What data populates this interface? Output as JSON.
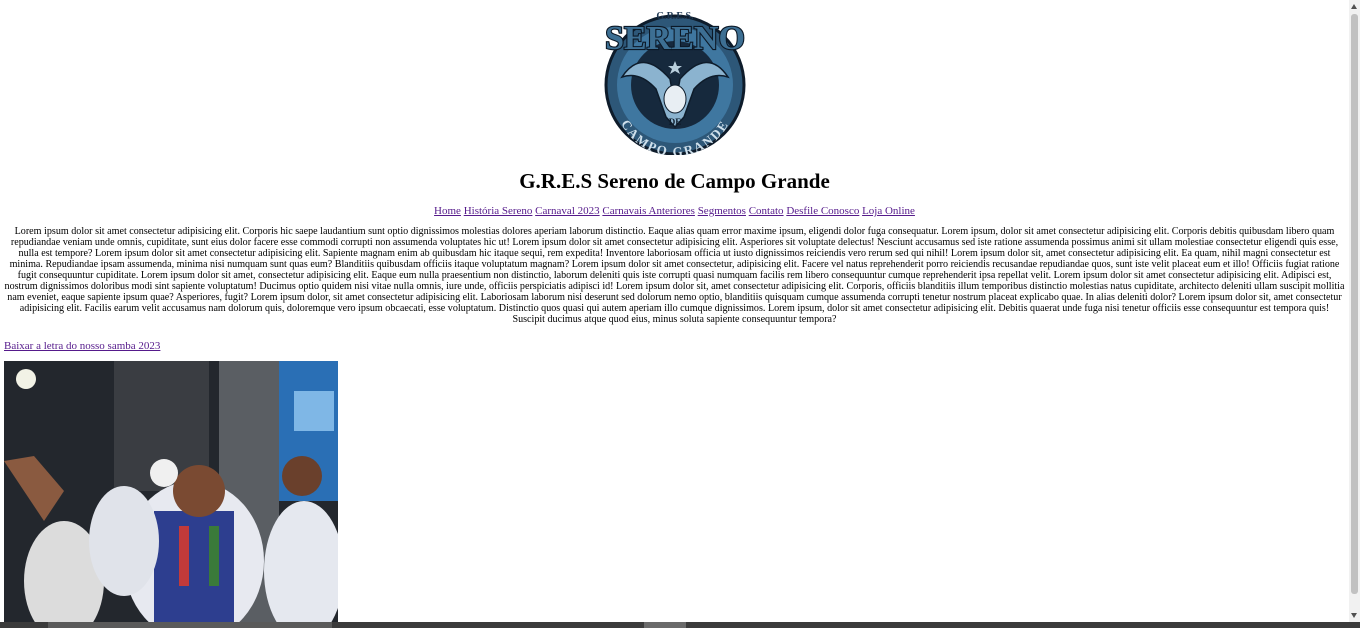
{
  "logo": {
    "top_text": "G.R.E.S.",
    "name": "SERENO",
    "bottom_text": "CAMPO GRANDE",
    "de_text": "DE"
  },
  "title": "G.R.E.S Sereno de Campo Grande",
  "nav": {
    "items": [
      {
        "label": "Home"
      },
      {
        "label": "História Sereno"
      },
      {
        "label": "Carnaval 2023"
      },
      {
        "label": "Carnavais Anteriores"
      },
      {
        "label": "Segmentos"
      },
      {
        "label": "Contato"
      },
      {
        "label": "Desfile Conosco"
      },
      {
        "label": "Loja Online"
      }
    ]
  },
  "body_text": "Lorem ipsum dolor sit amet consectetur adipisicing elit. Corporis hic saepe laudantium sunt optio dignissimos molestias dolores aperiam laborum distinctio. Eaque alias quam error maxime ipsum, eligendi dolor fuga consequatur. Lorem ipsum, dolor sit amet consectetur adipisicing elit. Corporis debitis quibusdam libero quam repudiandae veniam unde omnis, cupiditate, sunt eius dolor facere esse commodi corrupti non assumenda voluptates hic ut! Lorem ipsum dolor sit amet consectetur adipisicing elit. Asperiores sit voluptate delectus! Nesciunt accusamus sed iste ratione assumenda possimus animi sit ullam molestiae consectetur eligendi quis esse, nulla est tempore? Lorem ipsum dolor sit amet consectetur adipisicing elit. Sapiente magnam enim ab quibusdam hic itaque sequi, rem expedita! Inventore laboriosam officia ut iusto dignissimos reiciendis vero rerum sed qui nihil! Lorem ipsum dolor sit, amet consectetur adipisicing elit. Ea quam, nihil magni consectetur est minima. Repudiandae ipsam assumenda, minima nisi numquam sunt quas eum? Blanditiis quibusdam officiis itaque voluptatum magnam? Lorem ipsum dolor sit amet consectetur, adipisicing elit. Facere vel natus reprehenderit porro reiciendis recusandae repudiandae quos, sunt iste velit placeat eum et illo! Officiis fugiat ratione fugit consequuntur cupiditate. Lorem ipsum dolor sit amet, consectetur adipisicing elit. Eaque eum nulla praesentium non distinctio, laborum deleniti quis iste corrupti quasi numquam facilis rem libero consequuntur cumque reprehenderit ipsa repellat velit. Lorem ipsum dolor sit amet consectetur adipisicing elit. Adipisci est, nostrum dignissimos doloribus modi sint sapiente voluptatum! Ducimus optio quidem nisi vitae nulla omnis, iure unde, officiis perspiciatis adipisci id! Lorem ipsum dolor sit, amet consectetur adipisicing elit. Corporis, officiis blanditiis illum temporibus distinctio molestias natus cupiditate, architecto deleniti ullam suscipit mollitia nam eveniet, eaque sapiente ipsum quae? Asperiores, fugit? Lorem ipsum dolor, sit amet consectetur adipisicing elit. Laboriosam laborum nisi deserunt sed dolorum nemo optio, blanditiis quisquam cumque assumenda corrupti tenetur nostrum placeat explicabo quae. In alias deleniti dolor? Lorem ipsum dolor sit, amet consectetur adipisicing elit. Facilis earum velit accusamus nam dolorum quis, doloremque vero ipsum obcaecati, esse voluptatum. Distinctio quos quasi qui autem aperiam illo cumque dignissimos. Lorem ipsum, dolor sit amet consectetur adipisicing elit. Debitis quaerat unde fuga nisi tenetur officiis esse consequuntur est tempora quis! Suscipit ducimus atque quod eius, minus soluta sapiente consequuntur tempora?",
  "download_link": "Baixar a letra do nosso samba 2023",
  "colors": {
    "link": "#551a8b",
    "logo_blue": "#3d6f93",
    "logo_dark": "#13263a"
  }
}
